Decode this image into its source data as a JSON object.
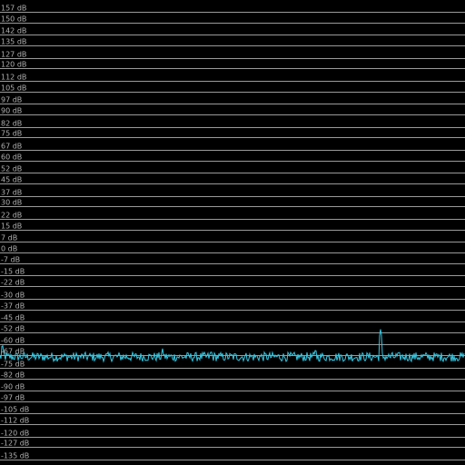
{
  "chart_data": {
    "type": "line",
    "title": "",
    "xlabel": "",
    "ylabel": "",
    "grid": true,
    "ylim": [
      -140,
      160
    ],
    "y_ticks": [
      157,
      150,
      142,
      135,
      127,
      120,
      112,
      105,
      97,
      90,
      82,
      75,
      67,
      60,
      52,
      45,
      37,
      30,
      22,
      15,
      7,
      0,
      -7,
      -15,
      -22,
      -30,
      -37,
      -45,
      -52,
      -60,
      -67,
      -75,
      -82,
      -90,
      -97,
      -105,
      -112,
      -120,
      -127,
      -135
    ],
    "y_tick_labels": [
      "157 dB",
      "150 dB",
      "142 dB",
      "135 dB",
      "127 dB",
      "120 dB",
      "112 dB",
      "105 dB",
      "97 dB",
      "90 dB",
      "82 dB",
      "75 dB",
      "67 dB",
      "60 dB",
      "52 dB",
      "45 dB",
      "37 dB",
      "30 dB",
      "22 dB",
      "15 dB",
      "7 dB",
      "0 dB",
      "-7 dB",
      "-15 dB",
      "-22 dB",
      "-30 dB",
      "-37 dB",
      "-45 dB",
      "-52 dB",
      "-60 dB",
      "-67 dB",
      "-75 dB",
      "-82 dB",
      "-90 dB",
      "-97 dB",
      "-105 dB",
      "-112 dB",
      "-120 dB",
      "-127 dB",
      "-135 dB"
    ],
    "series": [
      {
        "noise_floor_db": -68,
        "noise_amplitude_db": 3,
        "peaks": [
          {
            "x": 0.005,
            "db": -59
          },
          {
            "x": 0.82,
            "db": -50
          },
          {
            "x": 0.68,
            "db": -62
          },
          {
            "x": 0.455,
            "db": -63
          },
          {
            "x": 0.35,
            "db": -62
          }
        ]
      }
    ],
    "colors": {
      "background": "#000000",
      "grid": "#9a9a9a",
      "label": "#b0b0b0",
      "trace": "#38c6e0"
    }
  }
}
